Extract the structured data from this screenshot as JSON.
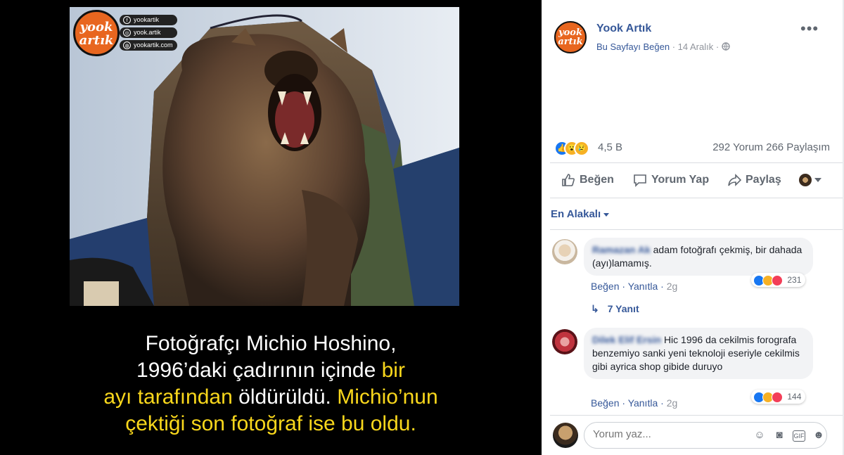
{
  "left": {
    "brand": {
      "logo_text_1": "yook",
      "logo_text_2": "artık",
      "lines": [
        "yookartik",
        "yook.artik",
        "yookartik.com"
      ]
    },
    "caption": {
      "line1": "Fotoğrafçı Michio Hoshino,",
      "line2_white": "1996’daki çadırının içinde ",
      "line2_yellow": "bir",
      "line3_yellow": "ayı tarafından",
      "line3_white": " öldürüldü. ",
      "line3_yellow2": "Michio’nun",
      "line4_yellow": "çektiği son fotoğraf ise bu oldu."
    }
  },
  "post": {
    "page_name": "Yook Artık",
    "like_page": "Bu Sayfayı Beğen",
    "date": " · 14 Aralık · ",
    "reaction_count": "4,5 B",
    "comment_count": "292 Yorum",
    "share_count": "266 Paylaşım",
    "actions": {
      "like": "Beğen",
      "comment": "Yorum Yap",
      "share": "Paylaş"
    },
    "sort_label": "En Alakalı"
  },
  "comments": [
    {
      "author": "Ramazan Ak",
      "text": "adam fotoğrafı çekmiş, bir dahada (ayı)lamamış.",
      "like": "Beğen",
      "reply": "Yanıtla",
      "time": "2g",
      "reactions": "231"
    },
    {
      "author": "Dilek Elif Ersin",
      "text": "Hic 1996 da cekilmis forografa benzemiyo sanki yeni teknoloji eseriyle cekilmis gibi ayrica shop gibide duruyo",
      "like": "Beğen",
      "reply": "Yanıtla",
      "time": "2g",
      "reactions": "144"
    }
  ],
  "replies_label": "7 Yanıt",
  "composer": {
    "placeholder": "Yorum yaz..."
  },
  "colors": {
    "accent": "#365899",
    "brand_orange": "#e8661f",
    "caption_yellow": "#f9d71c",
    "like_blue": "#1877f2"
  }
}
